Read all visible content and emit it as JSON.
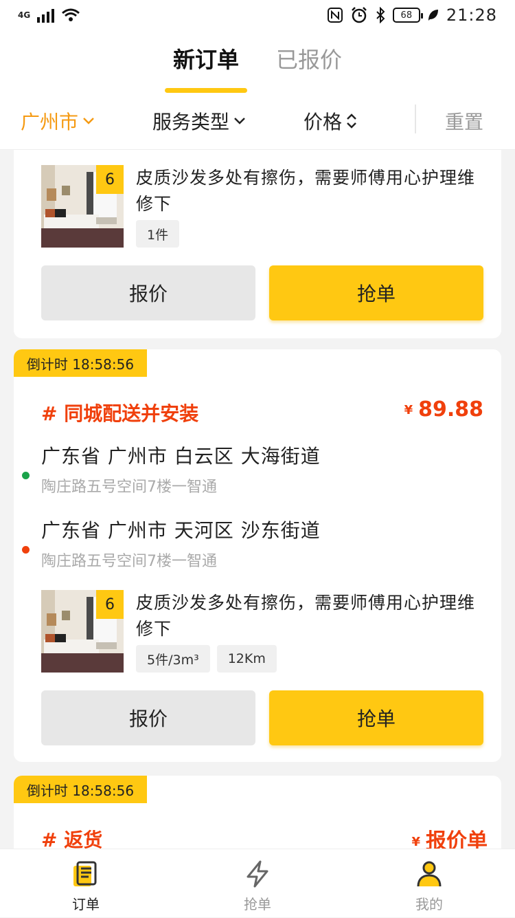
{
  "status_bar": {
    "network": "4G",
    "battery": "68",
    "time": "21:28"
  },
  "tabs": [
    {
      "label": "新订单",
      "active": true
    },
    {
      "label": "已报价",
      "active": false
    }
  ],
  "filters": {
    "city": "广州市",
    "service_type": "服务类型",
    "price": "价格",
    "reset": "重置"
  },
  "orders": [
    {
      "item": {
        "qty": "6",
        "description": "皮质沙发多处有擦伤，需要师傅用心护理维修下",
        "tags": [
          "1件"
        ]
      },
      "quote_btn": "报价",
      "grab_btn": "抢单"
    },
    {
      "countdown": "倒计时 18:58:56",
      "service": "# 同城配送并安装",
      "price_symbol": "¥",
      "price": "89.88",
      "from": {
        "main": "广东省 广州市 白云区 大海街道",
        "sub": "陶庄路五号空间7楼一智通"
      },
      "to": {
        "main": "广东省 广州市 天河区 沙东街道",
        "sub": "陶庄路五号空间7楼一智通"
      },
      "item": {
        "qty": "6",
        "description": "皮质沙发多处有擦伤，需要师傅用心护理维修下",
        "tags": [
          "5件/3m³",
          "12Km"
        ]
      },
      "quote_btn": "报价",
      "grab_btn": "抢单"
    },
    {
      "countdown": "倒计时 18:58:56",
      "service": "# 返货",
      "price_symbol": "¥",
      "price": "报价单"
    }
  ],
  "bottom_nav": [
    {
      "label": "订单",
      "icon": "order-document-icon",
      "active": true
    },
    {
      "label": "抢单",
      "icon": "lightning-icon",
      "active": false
    },
    {
      "label": "我的",
      "icon": "user-profile-icon",
      "active": false
    }
  ],
  "colors": {
    "accent": "#ffc812",
    "price_red": "#f0400c",
    "city_orange": "#f59a12",
    "start_dot": "#1aa34a",
    "end_dot": "#f0400c"
  }
}
